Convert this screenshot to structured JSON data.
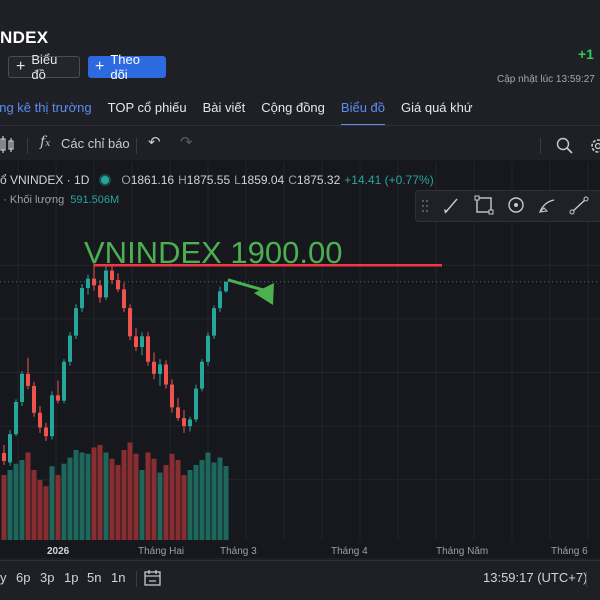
{
  "header": {
    "symbol_title": "NDEX",
    "chart_button": "Biểu đồ",
    "follow_button": "Theo dõi",
    "change_value": "+1",
    "updated_text": "Cập nhật lúc  13:59:27"
  },
  "tabs": [
    "ống kê thị trường",
    "TOP cổ phiếu",
    "Bài viết",
    "Cộng đồng",
    "Biểu đồ",
    "Giá quá khứ"
  ],
  "toolbar": {
    "indicators": "Các chỉ báo"
  },
  "legend": {
    "symbol": "ổ VNINDEX · 1D",
    "o_label": "O",
    "o_value": "1861.16",
    "h_label": "H",
    "h_value": "1875.55",
    "l_label": "L",
    "l_value": "1859.04",
    "c_label": "C",
    "c_value": "1875.32",
    "change": "+14.41 (+0.77%)",
    "volume_label": "e · Khối lượng",
    "volume_value": "591.506M"
  },
  "time_axis": {
    "labels": [
      "2026",
      "Tháng Hai",
      "Tháng 3",
      "Tháng 4",
      "Tháng Năm",
      "Tháng 6"
    ]
  },
  "timeframes": [
    "y",
    "6p",
    "3p",
    "1p",
    "5n",
    "1n"
  ],
  "clock": "13:59:17 (UTC+7)",
  "colors": {
    "up": "#26a69a",
    "down": "#ef5350",
    "annotation": "#4caf50",
    "target_line": "#f23645",
    "accent": "#2d6ae0"
  },
  "chart_data": {
    "type": "candlestick",
    "title": "VNINDEX 1900.00",
    "target_level": 1900.0,
    "last_price": 1875.32,
    "candles": [
      {
        "o": 1620,
        "h": 1632,
        "l": 1602,
        "c": 1608
      },
      {
        "o": 1606,
        "h": 1654,
        "l": 1601,
        "c": 1648
      },
      {
        "o": 1648,
        "h": 1700,
        "l": 1645,
        "c": 1696
      },
      {
        "o": 1696,
        "h": 1742,
        "l": 1690,
        "c": 1738
      },
      {
        "o": 1738,
        "h": 1762,
        "l": 1715,
        "c": 1720
      },
      {
        "o": 1720,
        "h": 1726,
        "l": 1674,
        "c": 1680
      },
      {
        "o": 1680,
        "h": 1690,
        "l": 1650,
        "c": 1658
      },
      {
        "o": 1658,
        "h": 1665,
        "l": 1638,
        "c": 1645
      },
      {
        "o": 1645,
        "h": 1712,
        "l": 1640,
        "c": 1706
      },
      {
        "o": 1706,
        "h": 1728,
        "l": 1694,
        "c": 1698
      },
      {
        "o": 1698,
        "h": 1760,
        "l": 1694,
        "c": 1756
      },
      {
        "o": 1756,
        "h": 1800,
        "l": 1750,
        "c": 1795
      },
      {
        "o": 1795,
        "h": 1842,
        "l": 1790,
        "c": 1836
      },
      {
        "o": 1836,
        "h": 1872,
        "l": 1830,
        "c": 1866
      },
      {
        "o": 1866,
        "h": 1886,
        "l": 1856,
        "c": 1880
      },
      {
        "o": 1880,
        "h": 1906,
        "l": 1862,
        "c": 1870
      },
      {
        "o": 1870,
        "h": 1878,
        "l": 1844,
        "c": 1852
      },
      {
        "o": 1852,
        "h": 1898,
        "l": 1848,
        "c": 1892
      },
      {
        "o": 1892,
        "h": 1902,
        "l": 1872,
        "c": 1878
      },
      {
        "o": 1878,
        "h": 1888,
        "l": 1860,
        "c": 1864
      },
      {
        "o": 1864,
        "h": 1874,
        "l": 1830,
        "c": 1836
      },
      {
        "o": 1836,
        "h": 1842,
        "l": 1788,
        "c": 1794
      },
      {
        "o": 1794,
        "h": 1806,
        "l": 1772,
        "c": 1778
      },
      {
        "o": 1778,
        "h": 1800,
        "l": 1766,
        "c": 1794
      },
      {
        "o": 1794,
        "h": 1800,
        "l": 1750,
        "c": 1756
      },
      {
        "o": 1756,
        "h": 1770,
        "l": 1730,
        "c": 1738
      },
      {
        "o": 1738,
        "h": 1760,
        "l": 1720,
        "c": 1752
      },
      {
        "o": 1752,
        "h": 1758,
        "l": 1716,
        "c": 1722
      },
      {
        "o": 1722,
        "h": 1730,
        "l": 1680,
        "c": 1688
      },
      {
        "o": 1688,
        "h": 1702,
        "l": 1668,
        "c": 1672
      },
      {
        "o": 1672,
        "h": 1684,
        "l": 1650,
        "c": 1660
      },
      {
        "o": 1660,
        "h": 1674,
        "l": 1652,
        "c": 1670
      },
      {
        "o": 1670,
        "h": 1722,
        "l": 1666,
        "c": 1716
      },
      {
        "o": 1716,
        "h": 1760,
        "l": 1712,
        "c": 1756
      },
      {
        "o": 1756,
        "h": 1800,
        "l": 1750,
        "c": 1795
      },
      {
        "o": 1795,
        "h": 1840,
        "l": 1790,
        "c": 1836
      },
      {
        "o": 1836,
        "h": 1868,
        "l": 1830,
        "c": 1861
      },
      {
        "o": 1861.16,
        "h": 1875.55,
        "l": 1859.04,
        "c": 1875.32
      }
    ],
    "volume": [
      520,
      560,
      610,
      640,
      700,
      560,
      480,
      430,
      590,
      520,
      610,
      660,
      720,
      700,
      690,
      740,
      760,
      700,
      650,
      600,
      720,
      780,
      690,
      560,
      700,
      650,
      540,
      600,
      690,
      640,
      520,
      560,
      600,
      640,
      700,
      620,
      660,
      591.506
    ]
  }
}
